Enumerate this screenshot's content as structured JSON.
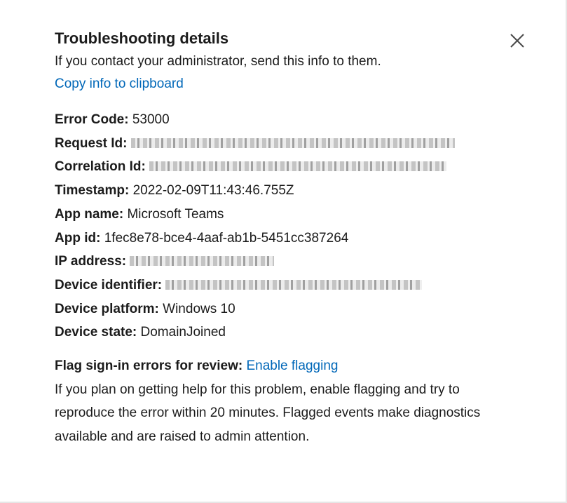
{
  "dialog": {
    "title": "Troubleshooting details",
    "subtitle": "If you contact your administrator, send this info to them.",
    "copy_link": "Copy info to clipboard",
    "close_icon": "close-icon"
  },
  "details": [
    {
      "label": "Error Code:",
      "value": "53000"
    },
    {
      "label": "Request Id:",
      "value": ""
    },
    {
      "label": "Correlation Id:",
      "value": ""
    },
    {
      "label": "Timestamp:",
      "value": "2022-02-09T11:43:46.755Z"
    },
    {
      "label": "App name:",
      "value": "Microsoft Teams"
    },
    {
      "label": "App id:",
      "value": "1fec8e78-bce4-4aaf-ab1b-5451cc387264"
    },
    {
      "label": "IP address:",
      "value": ""
    },
    {
      "label": "Device identifier:",
      "value": ""
    },
    {
      "label": "Device platform:",
      "value": "Windows 10"
    },
    {
      "label": "Device state:",
      "value": "DomainJoined"
    }
  ],
  "flagging": {
    "label": "Flag sign-in errors for review:",
    "link": "Enable flagging",
    "help": "If you plan on getting help for this problem, enable flagging and try to reproduce the error within 20 minutes. Flagged events make diagnostics available and are raised to admin attention."
  },
  "colors": {
    "link": "#0067b8",
    "text": "#1b1b1b",
    "background": "#ffffff"
  }
}
